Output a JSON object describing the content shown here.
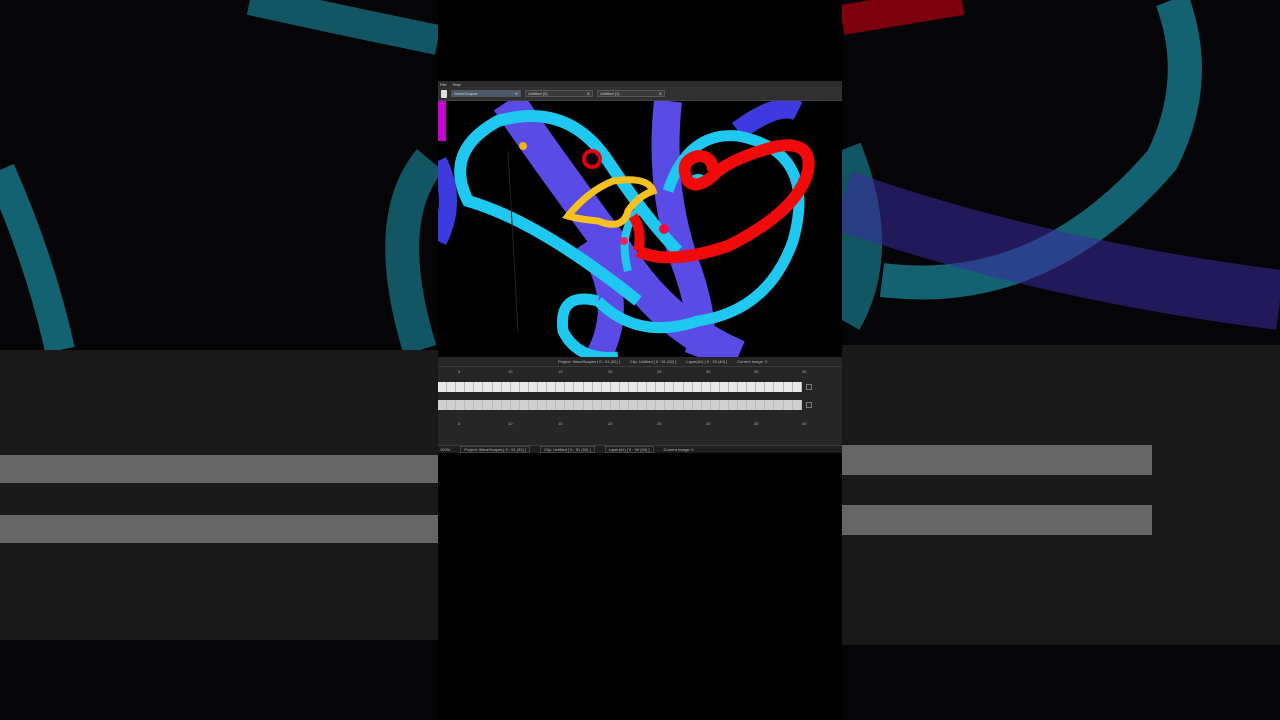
{
  "app": {
    "menu": [
      "File",
      "Help"
    ]
  },
  "tabs": [
    {
      "label": "WaveScapes",
      "active": true
    },
    {
      "label": "Untitled (2)",
      "active": false
    },
    {
      "label": "Untitled (1)",
      "active": false
    }
  ],
  "timeline": {
    "project": "Project: WaveScapes [ 0 : 51 (52) ]",
    "clip": "Clip: Untitled [ 0 : 51 (52) ]",
    "layer": "Layer(#1) [ 0 : 39 (40) ]",
    "current_image": "Current Image: 0",
    "ruler_marks": [
      "5",
      "10",
      "15",
      "20",
      "25",
      "30",
      "35",
      "40"
    ]
  },
  "status": {
    "zoom": "100%",
    "project": "Project: WaveScapes [ 0 : 51 (52) ]",
    "clip": "Clip: Untitled [ 0 : 51 (52) ]",
    "layer": "Layer(#1) [ 0 : 39 (40) ]",
    "current_image": "Current Image: 0"
  },
  "colors": {
    "cyan": "#1ec8f0",
    "violet": "#5a4ae6",
    "red": "#f00a0a",
    "yellow": "#f5c020",
    "magenta": "#c800d0"
  }
}
